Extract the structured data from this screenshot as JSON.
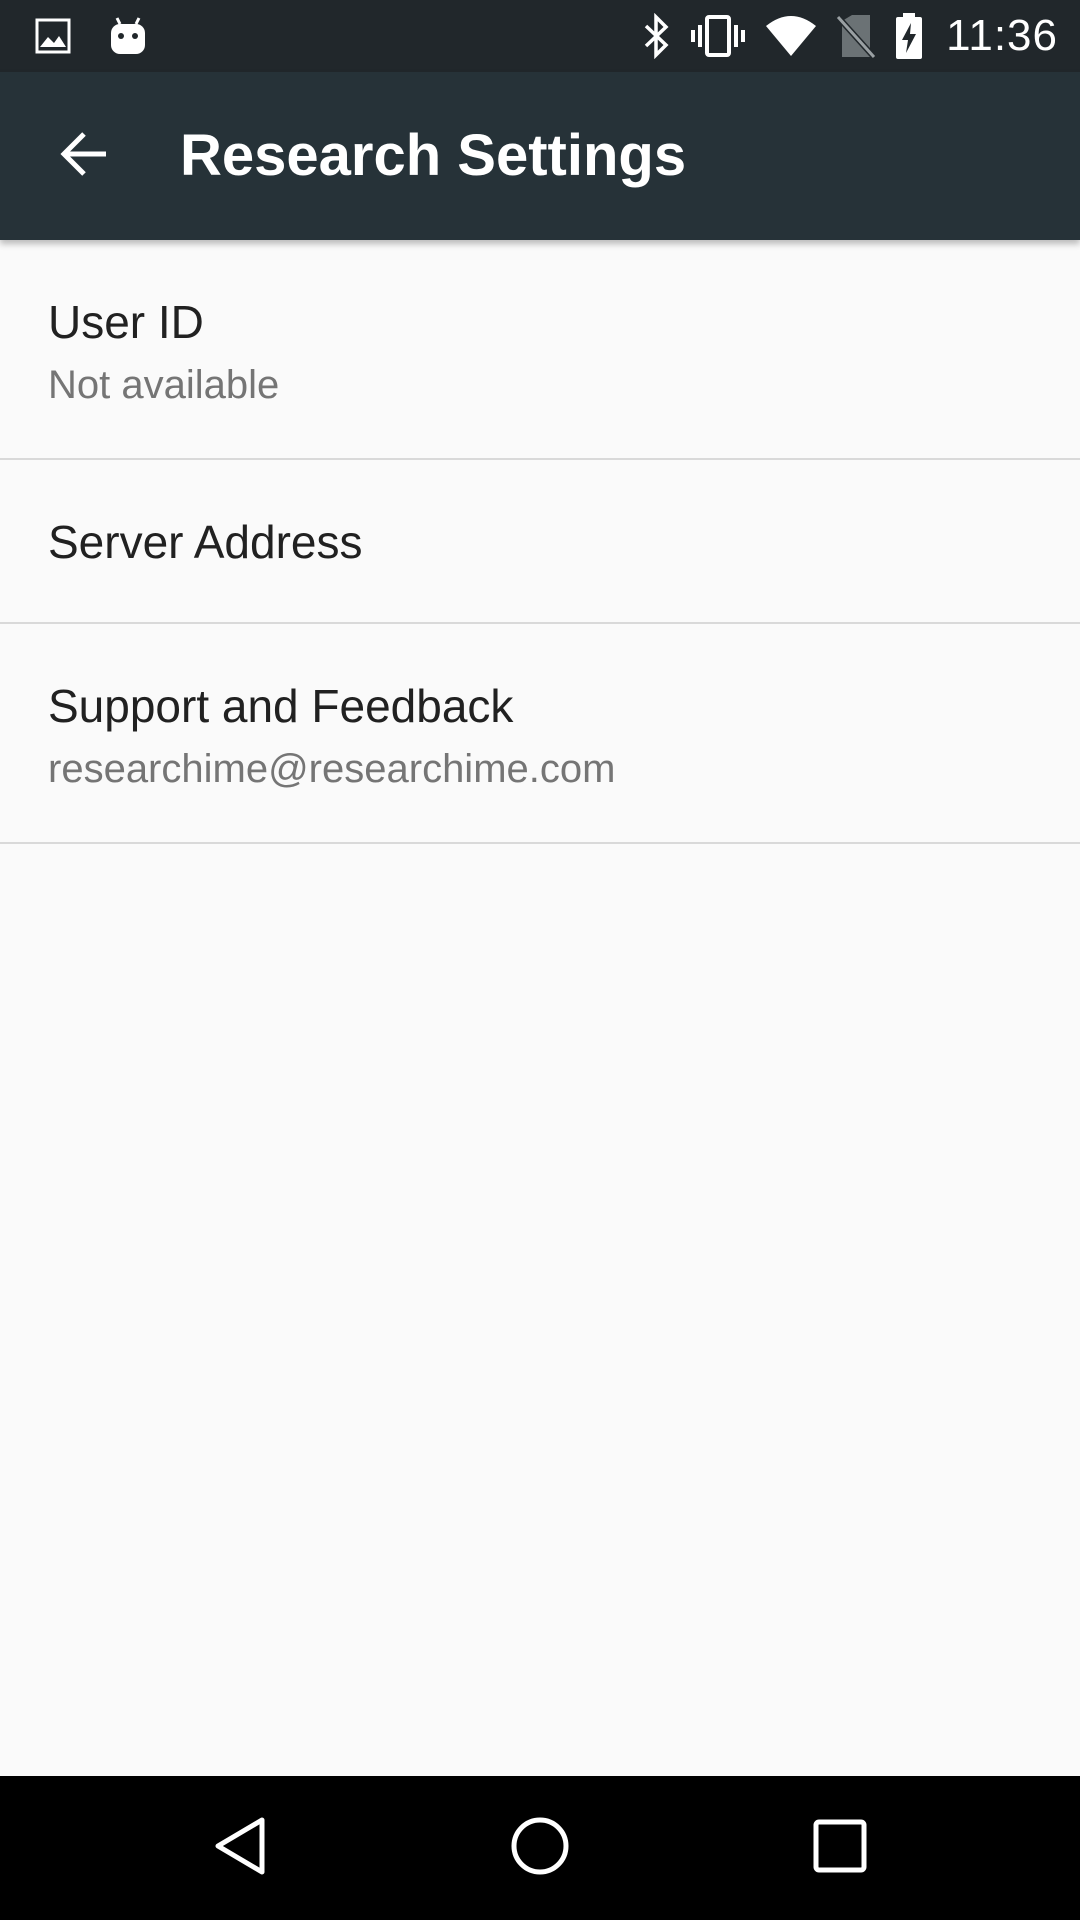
{
  "status_bar": {
    "time": "11:36",
    "icons": [
      "image-icon",
      "android-icon",
      "bluetooth-icon",
      "vibrate-icon",
      "wifi-icon",
      "no-sim-icon",
      "battery-charging-icon"
    ]
  },
  "app_bar": {
    "title": "Research Settings",
    "back_icon": "arrow-back-icon"
  },
  "preferences": [
    {
      "title": "User ID",
      "summary": "Not available"
    },
    {
      "title": "Server Address",
      "summary": ""
    },
    {
      "title": "Support and Feedback",
      "summary": "researchime@researchime.com"
    }
  ],
  "nav_bar": {
    "icons": [
      "nav-back-icon",
      "nav-home-icon",
      "nav-recents-icon"
    ]
  },
  "colors": {
    "status_bar": "#21272b",
    "app_bar": "#263238",
    "background": "#fafafa",
    "title_text": "#212121",
    "summary_text": "#757575",
    "divider": "#d9d9d9"
  }
}
